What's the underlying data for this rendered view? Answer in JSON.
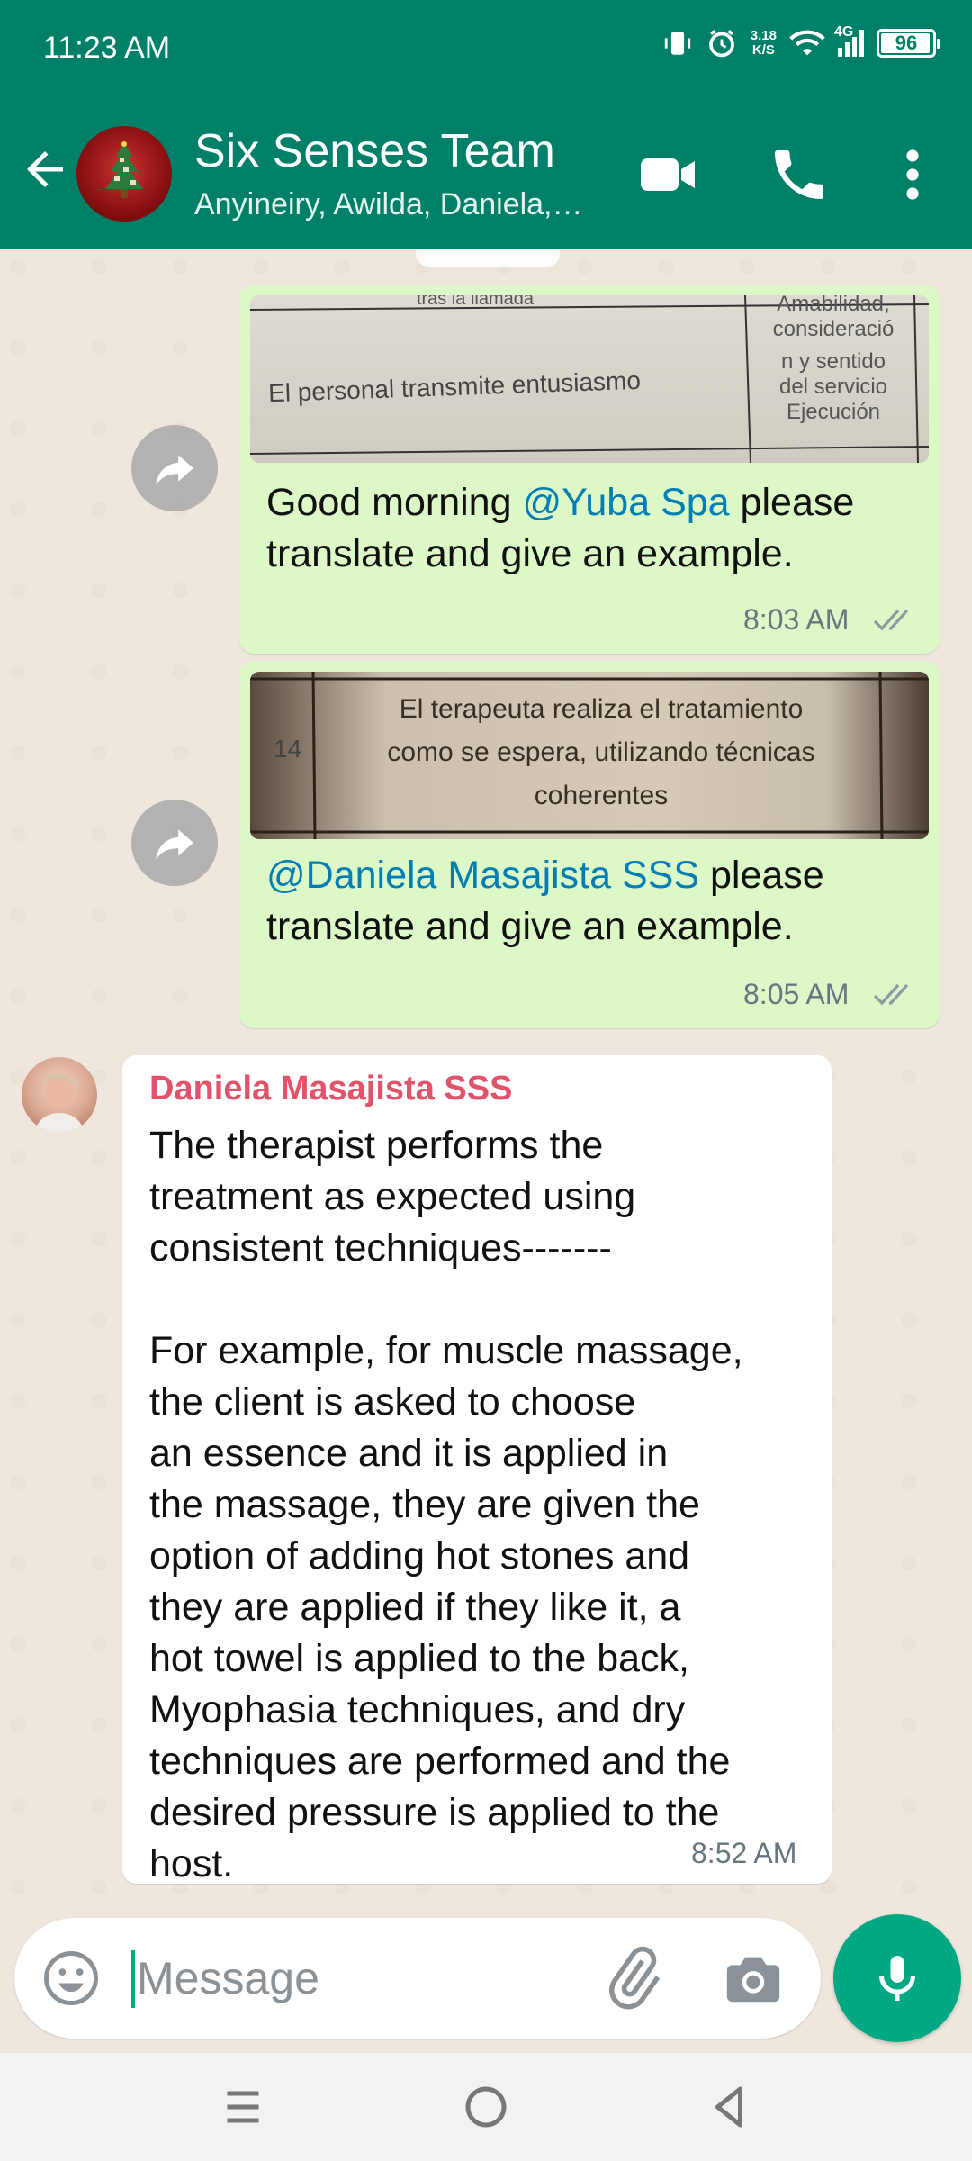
{
  "status_bar": {
    "time": "11:23 AM",
    "net_speed_value": "3.18",
    "net_speed_unit": "K/S",
    "network": "4G",
    "battery": "96",
    "battery_level": 0.96
  },
  "header": {
    "title": "Six Senses Team",
    "subtitle": "Anyineiry, Awilda, Daniela,…",
    "icons": [
      "back-arrow-icon",
      "video-call-icon",
      "phone-call-icon",
      "more-vert-icon"
    ]
  },
  "messages": [
    {
      "type": "outgoing",
      "image_text": "El personal transmite entusiasmo",
      "image_side_lines": [
        "Amabilidad,",
        "consideració",
        "n y sentido",
        "del servicio",
        "Ejecución"
      ],
      "image_top_text": "tras la llamada",
      "text_prefix": "Good morning ",
      "mention": "@Yuba Spa",
      "text_suffix_line1": " please",
      "text_line2": "translate and give an example.",
      "time": "8:03 AM"
    },
    {
      "type": "outgoing",
      "image_row_number": "14",
      "image_lines": [
        "El terapeuta realiza el tratamiento",
        "como se espera, utilizando técnicas",
        "coherentes"
      ],
      "mention": "@Daniela Masajista SSS",
      "text_suffix_line1": " please",
      "text_line2": "translate and give an example.",
      "time": "8:05 AM"
    },
    {
      "type": "incoming",
      "sender": "Daniela Masajista SSS",
      "lines": [
        "The therapist performs the",
        "treatment as expected using",
        "consistent techniques-------",
        "",
        "For example, for muscle massage,",
        "the client is asked to choose",
        "an essence and it is applied in",
        "the massage, they are given the",
        "option of adding hot stones and",
        "they are applied if they like it, a",
        "hot towel is applied to the back,",
        "Myophasia techniques, and dry",
        "techniques are performed and the",
        "desired pressure is applied to the",
        "host."
      ],
      "time": "8:52 AM"
    }
  ],
  "composer": {
    "placeholder": "Message",
    "icons": [
      "emoji-icon",
      "attach-icon",
      "camera-icon",
      "mic-icon"
    ]
  },
  "colors": {
    "brand": "#008069",
    "accent": "#00a884",
    "outgoing_bubble": "#dcf8c6",
    "mention": "#027eb5",
    "sender_name": "#e0536b"
  }
}
